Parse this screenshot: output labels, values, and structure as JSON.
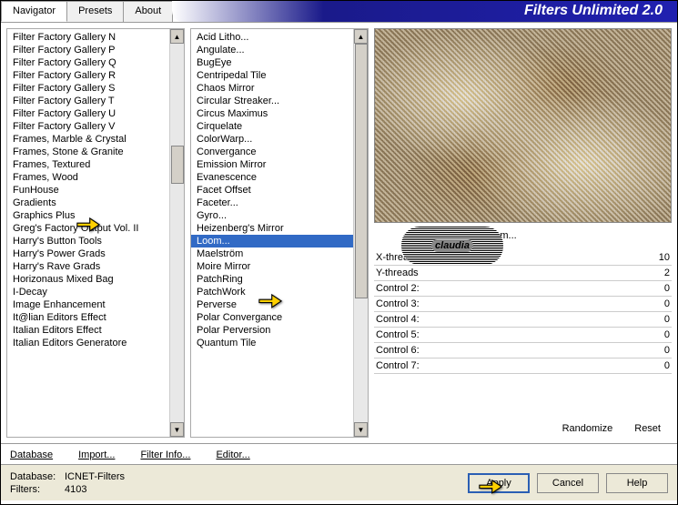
{
  "title_band": "Filters Unlimited 2.0",
  "tabs": [
    {
      "label": "Navigator",
      "active": true
    },
    {
      "label": "Presets",
      "active": false
    },
    {
      "label": "About",
      "active": false
    }
  ],
  "categories": [
    "Filter Factory Gallery N",
    "Filter Factory Gallery P",
    "Filter Factory Gallery Q",
    "Filter Factory Gallery R",
    "Filter Factory Gallery S",
    "Filter Factory Gallery T",
    "Filter Factory Gallery U",
    "Filter Factory Gallery V",
    "Frames, Marble & Crystal",
    "Frames, Stone & Granite",
    "Frames, Textured",
    "Frames, Wood",
    "FunHouse",
    "Gradients",
    "Graphics Plus",
    "Greg's Factory Output Vol. II",
    "Harry's Button Tools",
    "Harry's Power Grads",
    "Harry's Rave Grads",
    "Horizonaus Mixed Bag",
    "I-Decay",
    "Image Enhancement",
    "It@lian Editors Effect",
    "Italian Editors Effect",
    "Italian Editors Generatore"
  ],
  "category_highlight_index": 12,
  "filters": [
    "Acid Litho...",
    "Angulate...",
    "BugEye",
    "Centripedal Tile",
    "Chaos Mirror",
    "Circular Streaker...",
    "Circus Maximus",
    "Cirquelate",
    "ColorWarp...",
    "Convergance",
    "Emission Mirror",
    "Evanescence",
    "Facet Offset",
    "Faceter...",
    "Gyro...",
    "Heizenberg's Mirror",
    "Loom...",
    "Maelström",
    "Moire Mirror",
    "PatchRing",
    "PatchWork",
    "Perverse",
    "Polar Convergance",
    "Polar Perversion",
    "Quantum Tile"
  ],
  "filter_selected_index": 16,
  "selected_filter_name": "Loom...",
  "params": [
    {
      "name": "X-threads",
      "value": "10"
    },
    {
      "name": "Y-threads",
      "value": "2"
    },
    {
      "name": "Control 2:",
      "value": "0"
    },
    {
      "name": "Control 3:",
      "value": "0"
    },
    {
      "name": "Control 4:",
      "value": "0"
    },
    {
      "name": "Control 5:",
      "value": "0"
    },
    {
      "name": "Control 6:",
      "value": "0"
    },
    {
      "name": "Control 7:",
      "value": "0"
    }
  ],
  "right_links": {
    "randomize": "Randomize",
    "reset": "Reset"
  },
  "cmd_row": {
    "database": "Database",
    "import": "Import...",
    "filter_info": "Filter Info...",
    "editor": "Editor..."
  },
  "status": {
    "db_label": "Database:",
    "db_value": "ICNET-Filters",
    "filters_label": "Filters:",
    "filters_value": "4103"
  },
  "buttons": {
    "apply": "Apply",
    "cancel": "Cancel",
    "help": "Help"
  },
  "watermark": "claudia"
}
